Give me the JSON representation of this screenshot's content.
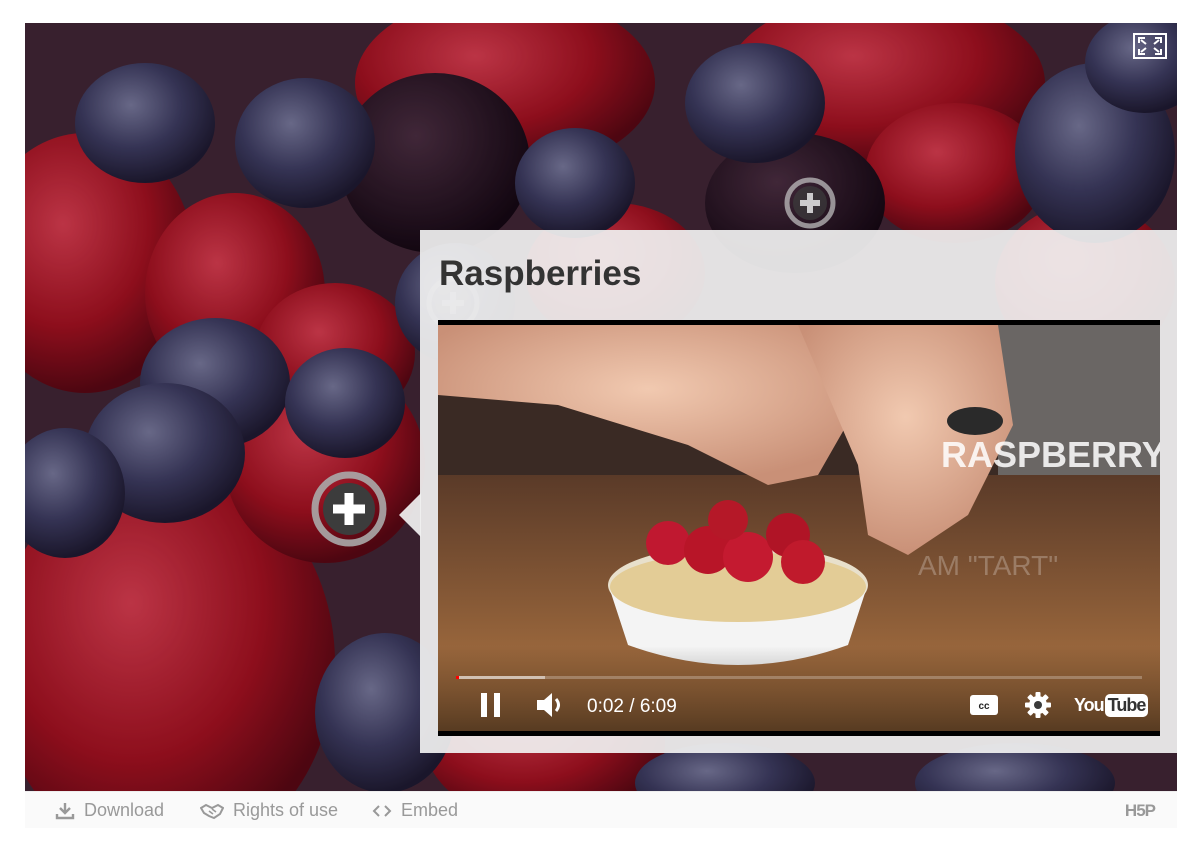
{
  "popup": {
    "title": "Raspberries"
  },
  "video": {
    "current_time": "0:02",
    "duration": "6:09",
    "time_display": "0:02 / 6:09",
    "progress_fraction": 0.005,
    "buffered_fraction": 0.13,
    "overlay_text_1": "RASPBERRY",
    "overlay_text_2": "AM \"TART\"",
    "logo_you": "You",
    "logo_tube": "Tube"
  },
  "footer": {
    "download_label": "Download",
    "rights_label": "Rights of use",
    "embed_label": "Embed",
    "brand": "H5P"
  },
  "icons": {
    "fullscreen": "fullscreen-icon",
    "hotspot": "plus-circle-icon",
    "play_pause": "pause-icon",
    "volume": "volume-icon",
    "captions": "cc-icon",
    "settings": "gear-icon",
    "download": "download-icon",
    "rights": "handshake-icon",
    "embed": "code-icon"
  },
  "colors": {
    "progress_played": "#ff0000",
    "popup_bg": "#f0f0f0",
    "footer_text": "#999999"
  }
}
